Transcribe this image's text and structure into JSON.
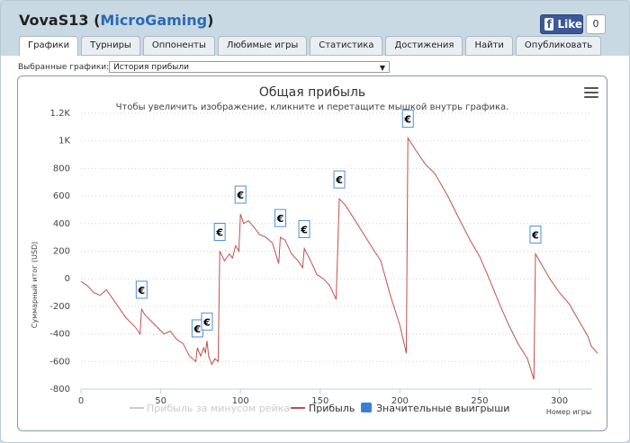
{
  "header": {
    "player": "VovaS13",
    "network_open": "(",
    "network": "MicroGaming",
    "network_close": ")"
  },
  "facebook": {
    "like_label": "Like",
    "count": "0"
  },
  "tabs": [
    {
      "label": "Графики",
      "active": true
    },
    {
      "label": "Турниры"
    },
    {
      "label": "Оппоненты"
    },
    {
      "label": "Любимые игры"
    },
    {
      "label": "Статистика"
    },
    {
      "label": "Достижения"
    },
    {
      "label": "Найти"
    },
    {
      "label": "Опубликовать"
    }
  ],
  "selector": {
    "label": "Выбранные графики:",
    "value": "История прибыли"
  },
  "chart_data": {
    "type": "line",
    "title": "Общая прибыль",
    "subtitle": "Чтобы увеличить изображение, кликните и перетащите мышкой внутрь графика.",
    "xlabel": "Номер игры",
    "ylabel": "Суммарный итог (USD)",
    "xlim": [
      0,
      320
    ],
    "ylim": [
      -800,
      1200
    ],
    "x_ticks": [
      0,
      50,
      100,
      150,
      200,
      250,
      300
    ],
    "y_ticks": [
      -800,
      -600,
      -400,
      -200,
      0,
      200,
      400,
      600,
      800,
      1000,
      1200
    ],
    "y_tick_labels": [
      "-800",
      "-600",
      "-400",
      "-200",
      "0",
      "200",
      "400",
      "600",
      "800",
      "1K",
      "1.2K"
    ],
    "grid": true,
    "legend": [
      {
        "name": "Прибыль за минусом рейка",
        "disabled": true
      },
      {
        "name": "Прибыль"
      },
      {
        "name": "Значительные выигрыши"
      }
    ],
    "series": [
      {
        "name": "Прибыль",
        "color": "#c0504d",
        "points": [
          [
            0,
            -20
          ],
          [
            4,
            -50
          ],
          [
            8,
            -100
          ],
          [
            12,
            -120
          ],
          [
            16,
            -80
          ],
          [
            22,
            -180
          ],
          [
            28,
            -280
          ],
          [
            34,
            -350
          ],
          [
            37,
            -400
          ],
          [
            38,
            -220
          ],
          [
            40,
            -260
          ],
          [
            46,
            -330
          ],
          [
            52,
            -400
          ],
          [
            56,
            -380
          ],
          [
            60,
            -440
          ],
          [
            64,
            -470
          ],
          [
            68,
            -560
          ],
          [
            72,
            -600
          ],
          [
            73,
            -500
          ],
          [
            75,
            -560
          ],
          [
            77,
            -500
          ],
          [
            78,
            -540
          ],
          [
            79,
            -450
          ],
          [
            80,
            -560
          ],
          [
            82,
            -620
          ],
          [
            84,
            -580
          ],
          [
            86,
            -600
          ],
          [
            87,
            200
          ],
          [
            90,
            130
          ],
          [
            93,
            180
          ],
          [
            95,
            150
          ],
          [
            97,
            240
          ],
          [
            99,
            200
          ],
          [
            100,
            470
          ],
          [
            102,
            400
          ],
          [
            105,
            420
          ],
          [
            108,
            380
          ],
          [
            112,
            320
          ],
          [
            116,
            300
          ],
          [
            120,
            260
          ],
          [
            124,
            110
          ],
          [
            125,
            300
          ],
          [
            128,
            280
          ],
          [
            132,
            180
          ],
          [
            136,
            130
          ],
          [
            139,
            80
          ],
          [
            140,
            220
          ],
          [
            144,
            130
          ],
          [
            148,
            30
          ],
          [
            152,
            0
          ],
          [
            156,
            -50
          ],
          [
            160,
            -150
          ],
          [
            162,
            580
          ],
          [
            166,
            530
          ],
          [
            172,
            420
          ],
          [
            178,
            310
          ],
          [
            184,
            200
          ],
          [
            188,
            130
          ],
          [
            194,
            -120
          ],
          [
            200,
            -340
          ],
          [
            204,
            -540
          ],
          [
            205,
            1020
          ],
          [
            210,
            930
          ],
          [
            216,
            830
          ],
          [
            222,
            760
          ],
          [
            230,
            600
          ],
          [
            236,
            460
          ],
          [
            244,
            280
          ],
          [
            250,
            160
          ],
          [
            256,
            0
          ],
          [
            262,
            -170
          ],
          [
            268,
            -330
          ],
          [
            274,
            -470
          ],
          [
            280,
            -580
          ],
          [
            284,
            -730
          ],
          [
            285,
            180
          ],
          [
            288,
            120
          ],
          [
            294,
            0
          ],
          [
            300,
            -100
          ],
          [
            306,
            -180
          ],
          [
            312,
            -300
          ],
          [
            318,
            -420
          ],
          [
            320,
            -490
          ],
          [
            324,
            -540
          ]
        ]
      }
    ],
    "big_wins": [
      {
        "x": 38,
        "y": -220,
        "label": "€"
      },
      {
        "x": 73,
        "y": -500,
        "label": "€"
      },
      {
        "x": 79,
        "y": -450,
        "label": "€"
      },
      {
        "x": 87,
        "y": 200,
        "label": "€"
      },
      {
        "x": 100,
        "y": 470,
        "label": "€"
      },
      {
        "x": 125,
        "y": 300,
        "label": "€"
      },
      {
        "x": 140,
        "y": 220,
        "label": "€"
      },
      {
        "x": 162,
        "y": 580,
        "label": "€"
      },
      {
        "x": 205,
        "y": 1020,
        "label": "€"
      },
      {
        "x": 285,
        "y": 180,
        "label": "€"
      }
    ]
  }
}
